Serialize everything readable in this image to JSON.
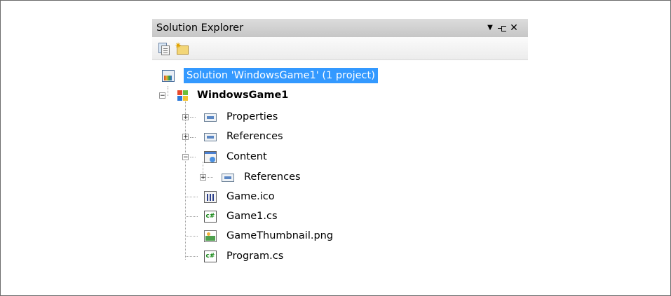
{
  "panel": {
    "title": "Solution Explorer",
    "buttons": {
      "dropdown_icon": "chevron-down-icon",
      "pin_icon": "pin-icon",
      "close_icon": "close-icon"
    }
  },
  "toolbar": {
    "items": [
      {
        "name": "properties-button",
        "icon": "properties-icon"
      },
      {
        "name": "show-all-files-button",
        "icon": "show-all-files-icon"
      }
    ]
  },
  "tree": {
    "solution": "Solution 'WindowsGame1' (1 project)",
    "project": "WindowsGame1",
    "properties": "Properties",
    "references": "References",
    "content": "Content",
    "content_references": "References",
    "game_ico": "Game.ico",
    "game1_cs": "Game1.cs",
    "thumbnail": "GameThumbnail.png",
    "program_cs": "Program.cs"
  },
  "colors": {
    "selection": "#3399ff",
    "titlebar": "#d0d0d0"
  }
}
